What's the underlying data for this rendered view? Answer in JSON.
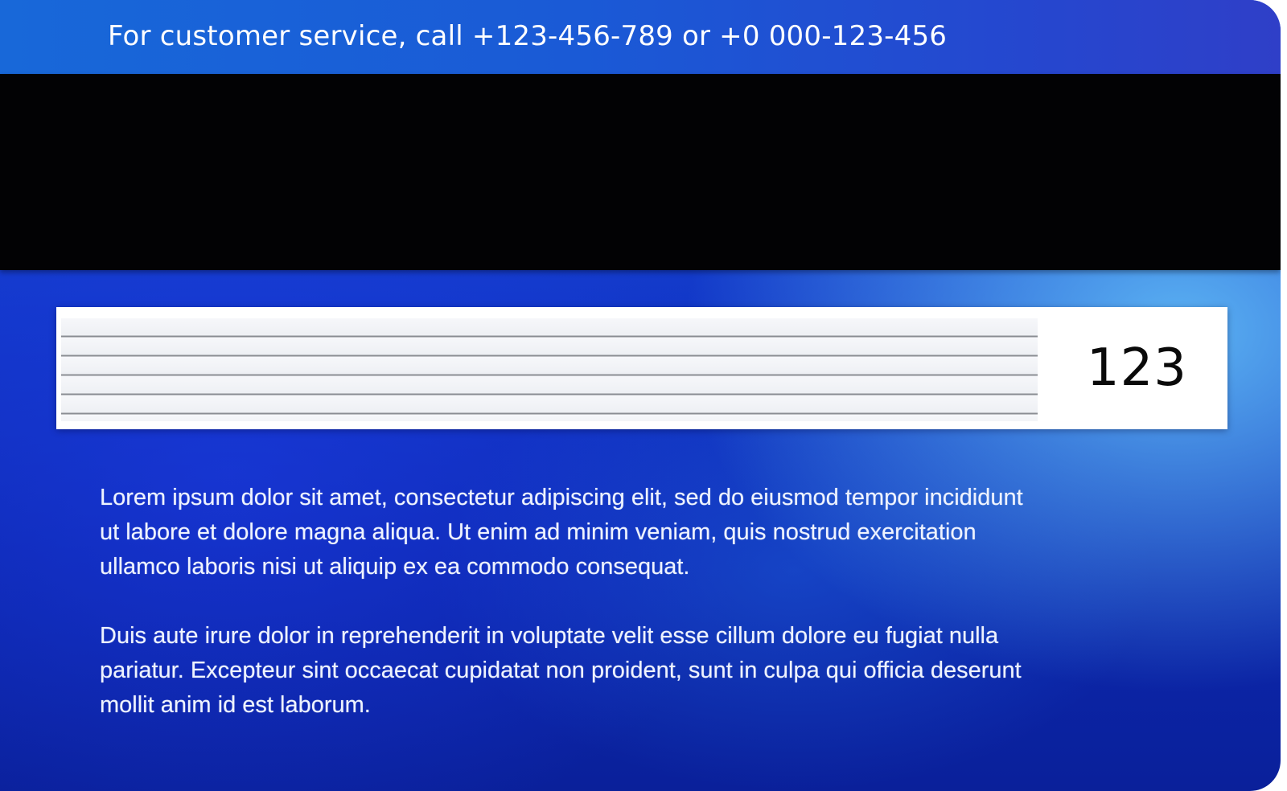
{
  "card_back": {
    "service_line": "For customer service, call +123-456-789 or +0 000-123-456",
    "cvv": "123",
    "terms": [
      "Lorem ipsum dolor sit amet, consectetur adipiscing elit, sed do eiusmod tempor incididunt\nut labore et dolore magna aliqua. Ut enim ad minim veniam, quis nostrud exercitation\nullamco laboris nisi ut aliquip ex ea commodo consequat.",
      "Duis aute irure dolor in reprehenderit in voluptate velit esse cillum dolore eu fugiat nulla\npariatur. Excepteur sint occaecat cupidatat non proident, sunt in culpa qui officia deserunt\nmollit anim id est laborum."
    ]
  },
  "colors": {
    "card_blue": "#1238c8",
    "card_light_blue": "#5fb9f5",
    "magnetic_stripe": "#020204",
    "signature_panel": "#ffffff"
  }
}
